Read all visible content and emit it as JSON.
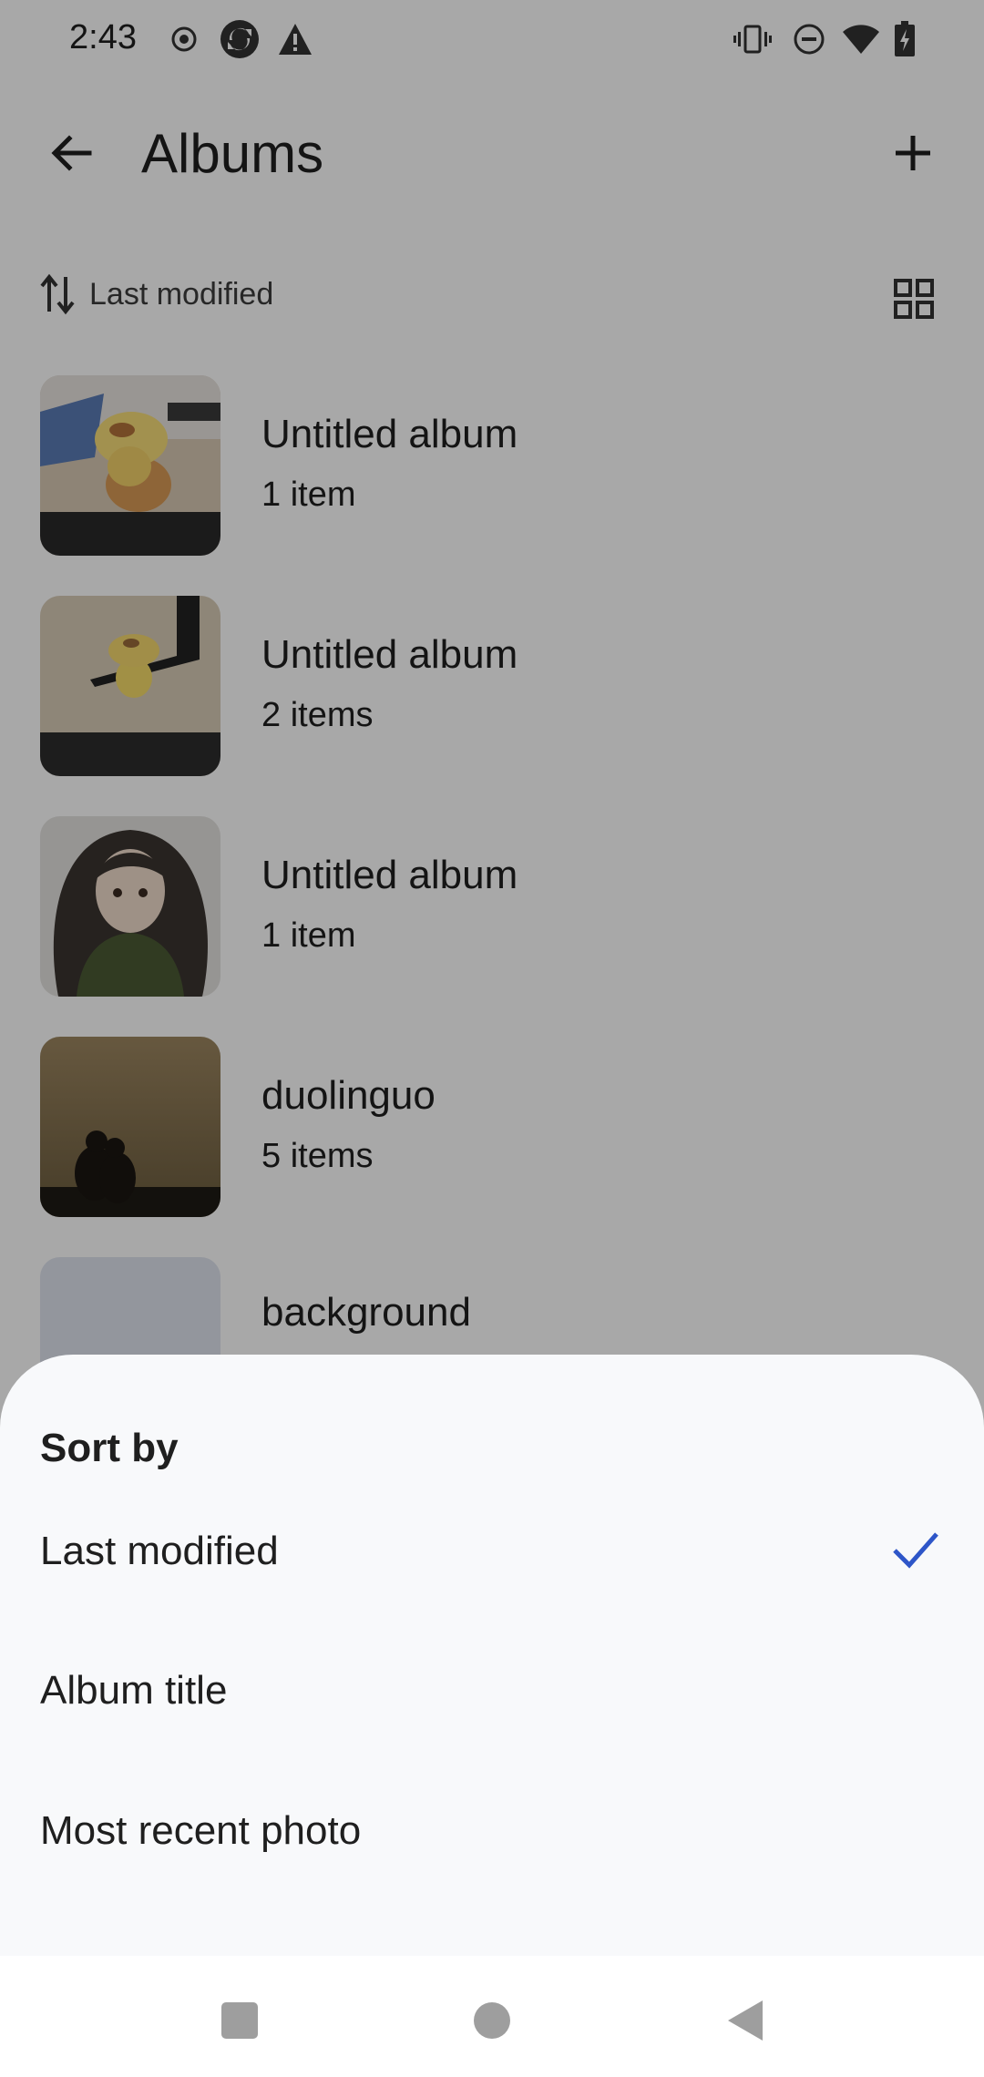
{
  "status_bar": {
    "time": "2:43",
    "left_icons": [
      "record-icon",
      "sync-icon",
      "warning-icon"
    ],
    "right_icons": [
      "vibrate-icon",
      "do-not-disturb-icon",
      "wifi-icon",
      "battery-charging-icon"
    ]
  },
  "app_bar": {
    "title": "Albums",
    "back_icon": "arrow-back-icon",
    "add_icon": "plus-icon"
  },
  "sort_row": {
    "label": "Last modified",
    "sort_icon": "swap-vert-icon",
    "view_icon": "grid-view-icon"
  },
  "albums": [
    {
      "title": "Untitled album",
      "count": "1 item"
    },
    {
      "title": "Untitled album",
      "count": "2 items"
    },
    {
      "title": "Untitled album",
      "count": "1 item"
    },
    {
      "title": "duolinguo",
      "count": "5 items"
    },
    {
      "title": "background",
      "count": ""
    }
  ],
  "sheet": {
    "title": "Sort by",
    "options": [
      {
        "label": "Last modified",
        "selected": true
      },
      {
        "label": "Album title",
        "selected": false
      },
      {
        "label": "Most recent photo",
        "selected": false
      }
    ],
    "check_color": "#2e56c8"
  },
  "nav_bar": {
    "buttons": [
      "recents-square-icon",
      "home-circle-icon",
      "back-triangle-icon"
    ]
  }
}
